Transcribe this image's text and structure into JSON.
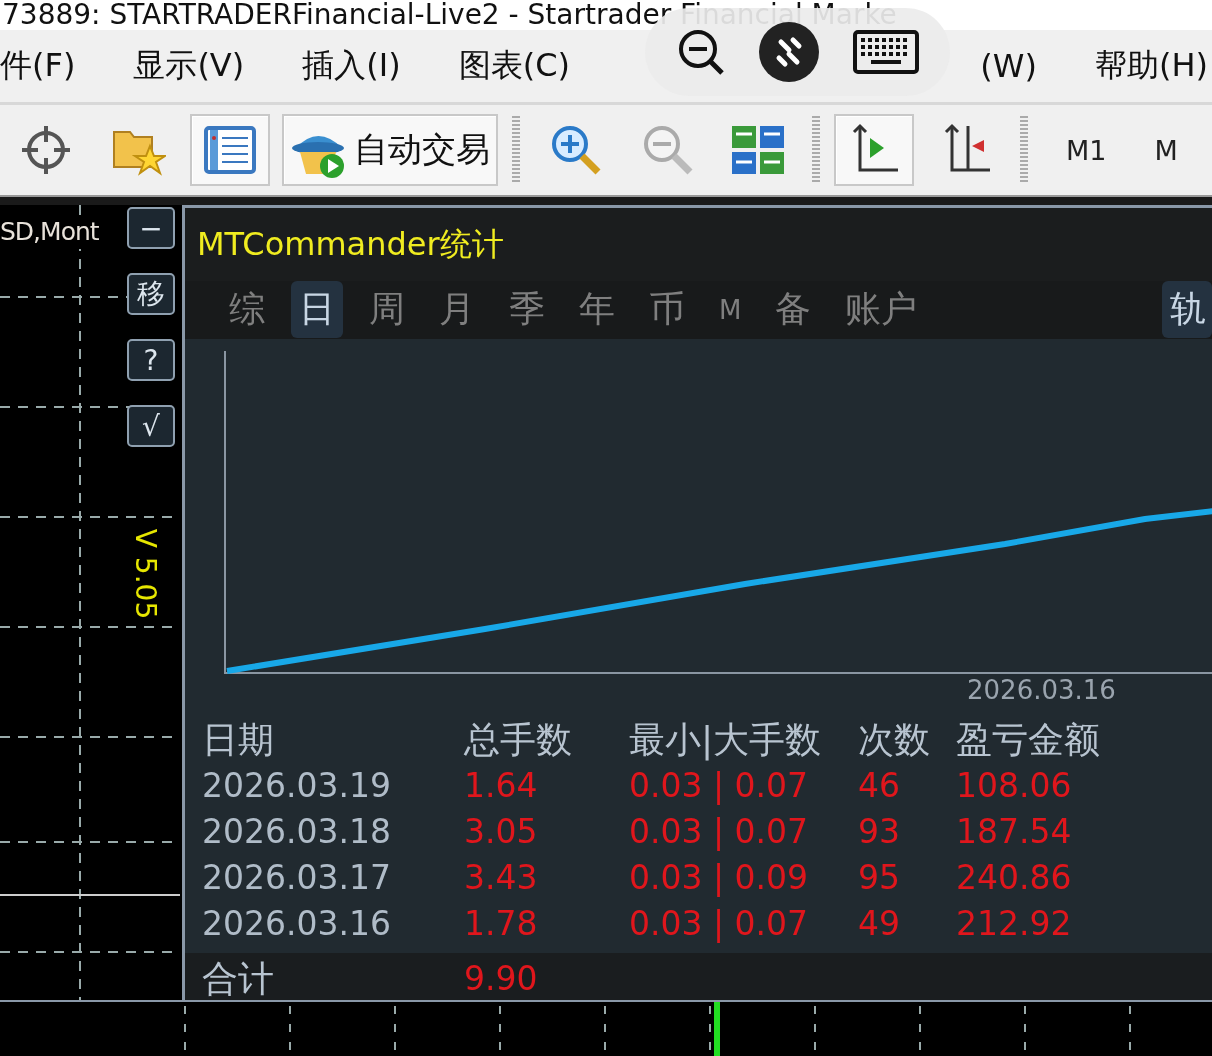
{
  "window": {
    "title": "73889: STARTRADERFinancial-Live2 - Startrader Financial Marke"
  },
  "menu": [
    {
      "label": "件(F)"
    },
    {
      "label": "显示(V)"
    },
    {
      "label": "插入(I)"
    },
    {
      "label": "图表(C)"
    },
    {
      "label": "(W)"
    },
    {
      "label": "帮助(H)"
    }
  ],
  "toolbar": [
    {
      "kind": "tool",
      "pressed": false
    },
    {
      "kind": "tool",
      "pressed": false
    },
    {
      "kind": "tool",
      "pressed": true
    },
    {
      "kind": "labeled",
      "label": "自动交易",
      "pressed": true
    },
    {
      "kind": "separator"
    },
    {
      "kind": "tool",
      "pressed": false
    },
    {
      "kind": "tool",
      "pressed": false
    },
    {
      "kind": "tool",
      "pressed": false
    },
    {
      "kind": "separator"
    },
    {
      "kind": "tool",
      "pressed": true
    },
    {
      "kind": "tool",
      "pressed": false
    },
    {
      "kind": "separator"
    },
    {
      "kind": "timeframe",
      "label": "M1"
    },
    {
      "kind": "timeframe",
      "label": "M"
    }
  ],
  "chart_window": {
    "symbol_label": "SD,Mont",
    "side_buttons": [
      "−",
      "移",
      "?",
      "√"
    ],
    "version": "V 5.05"
  },
  "stats": {
    "title": "MTCommander统计",
    "tabs": [
      {
        "label": "综",
        "selected": false
      },
      {
        "label": "日",
        "selected": true
      },
      {
        "label": "周",
        "selected": false
      },
      {
        "label": "月",
        "selected": false
      },
      {
        "label": "季",
        "selected": false
      },
      {
        "label": "年",
        "selected": false
      },
      {
        "label": "币",
        "selected": false
      },
      {
        "label": "M",
        "selected": false
      },
      {
        "label": "备",
        "selected": false
      },
      {
        "label": "账户",
        "selected": false
      }
    ],
    "side_tab": {
      "label": "轨"
    },
    "chart_x_label": "2026.03.16",
    "columns": [
      "日期",
      "总手数",
      "最小|大手数",
      "次数",
      "盈亏金额"
    ],
    "rows": [
      [
        "2026.03.19",
        "1.64",
        "0.03 | 0.07",
        "46",
        "108.06"
      ],
      [
        "2026.03.18",
        "3.05",
        "0.03 | 0.07",
        "93",
        "187.54"
      ],
      [
        "2026.03.17",
        "3.43",
        "0.03 | 0.09",
        "95",
        "240.86"
      ],
      [
        "2026.03.16",
        "1.78",
        "0.03 | 0.07",
        "49",
        "212.92"
      ]
    ],
    "total": {
      "label": "合计",
      "lots": "9.90"
    }
  }
}
